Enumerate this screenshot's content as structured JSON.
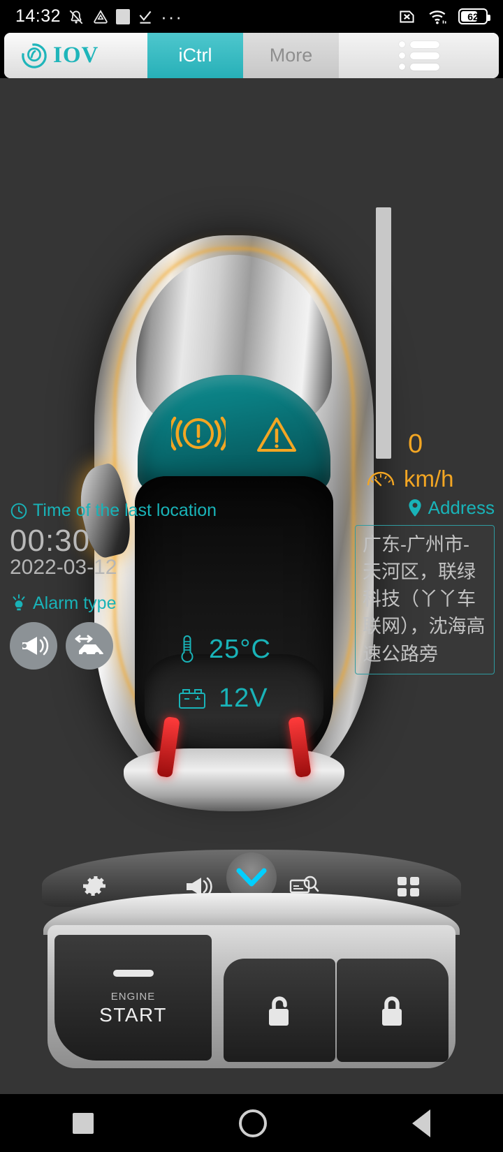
{
  "status_bar": {
    "time": "14:32",
    "battery_percent": "62",
    "icons": [
      "bell-muted-icon",
      "triangle-drive-icon",
      "square-app-icon",
      "check-task-icon",
      "more-dots-icon",
      "sim-off-icon",
      "wifi-icon",
      "battery-icon"
    ]
  },
  "nav": {
    "brand": "IOV",
    "brand_icon": "iov-logo-icon",
    "tabs": [
      {
        "label": "iCtrl",
        "active": true
      },
      {
        "label": "More",
        "active": false
      }
    ],
    "menu_icon": "hamburger-list-icon"
  },
  "vehicle": {
    "warnings": [
      {
        "name": "tire-pressure-warning-icon",
        "label": "((!))"
      },
      {
        "name": "general-warning-icon",
        "label": "!"
      }
    ],
    "temperature": {
      "icon": "thermometer-icon",
      "value": "25°C"
    },
    "voltage": {
      "icon": "car-battery-icon",
      "value": "12V"
    }
  },
  "speed": {
    "value": "0",
    "unit": "km/h",
    "icon": "speedometer-icon"
  },
  "location": {
    "title": "Time of the last location",
    "title_icon": "clock-icon",
    "time": "00:30",
    "date": "2022-03-12"
  },
  "alarm": {
    "title": "Alarm type",
    "title_icon": "bulb-alert-icon",
    "items": [
      {
        "name": "siren-horn-icon"
      },
      {
        "name": "vehicle-tow-move-icon"
      }
    ]
  },
  "address": {
    "title": "Address",
    "title_icon": "location-pin-icon",
    "value": "广东-广州市-天河区，联绿科技（丫丫车联网），沈海高速公路旁"
  },
  "console": {
    "top_buttons": [
      {
        "name": "settings-gear-icon"
      },
      {
        "name": "horn-speaker-icon"
      },
      {
        "name": "locate-search-icon"
      },
      {
        "name": "grid-apps-icon"
      }
    ],
    "collapse_icon": "chevron-down-icon",
    "engine_start": {
      "sub_label": "ENGINE",
      "main_label": "START",
      "icon": "dash-line-icon"
    },
    "unlock": {
      "name": "unlock-icon"
    },
    "lock": {
      "name": "lock-icon"
    }
  },
  "android_nav": {
    "recent": "square-recent-icon",
    "home": "circle-home-icon",
    "back": "triangle-back-icon"
  },
  "colors": {
    "accent_teal": "#19b3b8",
    "accent_orange": "#f3a623",
    "stage_bg": "#353535",
    "cyan": "#00cfff"
  }
}
